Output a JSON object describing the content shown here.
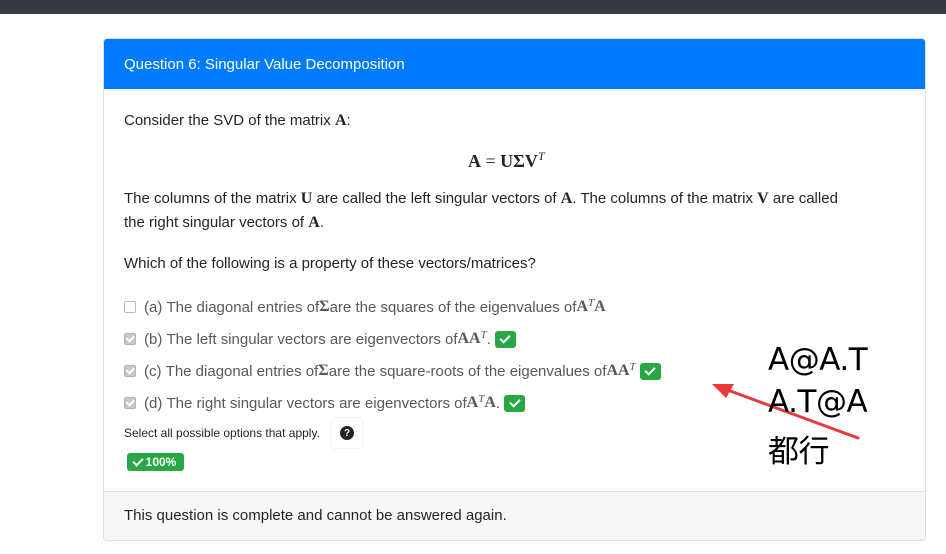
{
  "question": {
    "title": "Question 6: Singular Value Decomposition",
    "intro": "Consider the SVD of the matrix ",
    "intro_matrix": "A",
    "intro_end": ":",
    "equation": {
      "lhs": "A",
      "eq": "=",
      "rhs": "UΣV",
      "rhs_sup": "T"
    },
    "para1_a": "The columns of the matrix ",
    "para1_U": "U",
    "para1_b": " are called the left singular vectors of ",
    "para1_A1": "A",
    "para1_c": ". The columns of the matrix ",
    "para1_V": "V",
    "para1_d": " are called",
    "para2_a": "the right singular vectors of ",
    "para2_A": "A",
    "para2_b": ".",
    "prompt": "Which of the following is a property of these vectors/matrices?",
    "options": [
      {
        "label": "(a)",
        "text": "The diagonal entries of ",
        "sym": "Σ",
        "text2": " are the squares of the eigenvalues of ",
        "math": "A",
        "sup": "T",
        "math2": "A",
        "tail": "",
        "checked": false,
        "correct": false
      },
      {
        "label": "(b)",
        "text": "The left singular vectors are eigenvectors of ",
        "sym": "",
        "text2": "",
        "math": "AA",
        "sup": "T",
        "math2": "",
        "tail": ".",
        "checked": true,
        "correct": true
      },
      {
        "label": "(c)",
        "text": "The diagonal entries of ",
        "sym": "Σ",
        "text2": " are the square-roots of the eigenvalues of ",
        "math": "AA",
        "sup": "T",
        "math2": "",
        "tail": "",
        "checked": true,
        "correct": true
      },
      {
        "label": "(d)",
        "text": "The right singular vectors are eigenvectors of ",
        "sym": "",
        "text2": "",
        "math": "A",
        "sup": "T",
        "math2": "A",
        "tail": ".",
        "checked": true,
        "correct": true
      }
    ],
    "hint": "Select all possible options that apply.",
    "help_icon": "question-circle-icon",
    "score": "100%",
    "footer": "This question is complete and cannot be answered again."
  },
  "annotation": {
    "lines": [
      "A@A.T",
      "A.T@A",
      "都行"
    ],
    "arrow_color": "#e8393a"
  },
  "colors": {
    "header_bg": "#007bff",
    "success": "#28a745",
    "topbar": "#343a40",
    "footer_bg": "#f7f7f7"
  }
}
